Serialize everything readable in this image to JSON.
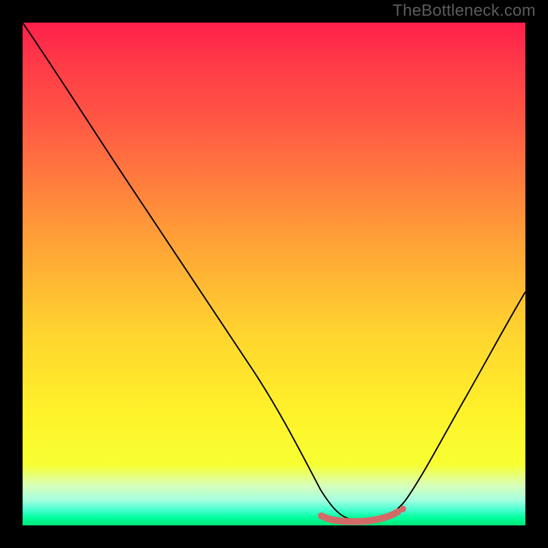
{
  "watermark": "TheBottleneck.com",
  "chart_data": {
    "type": "line",
    "title": "",
    "xlabel": "",
    "ylabel": "",
    "xlim": [
      0,
      100
    ],
    "ylim": [
      0,
      100
    ],
    "grid": false,
    "legend": false,
    "annotations": [],
    "series": [
      {
        "name": "bottleneck-curve",
        "x": [
          0,
          6,
          12,
          18,
          24,
          30,
          36,
          42,
          48,
          54,
          58,
          61,
          64,
          67,
          70,
          73,
          77,
          82,
          88,
          94,
          100
        ],
        "y": [
          100,
          90,
          80,
          70,
          60,
          50,
          40,
          30,
          20,
          10,
          4,
          1,
          0,
          0,
          0,
          1,
          4,
          12,
          24,
          38,
          55
        ],
        "color": "#000000"
      }
    ],
    "optimal_band": {
      "x_start": 59,
      "x_end": 75,
      "y": 2,
      "color": "#d46a68"
    },
    "background_gradient": {
      "top": "#ff1f4b",
      "middle": "#ffd52f",
      "bottom": "#00e676"
    }
  }
}
